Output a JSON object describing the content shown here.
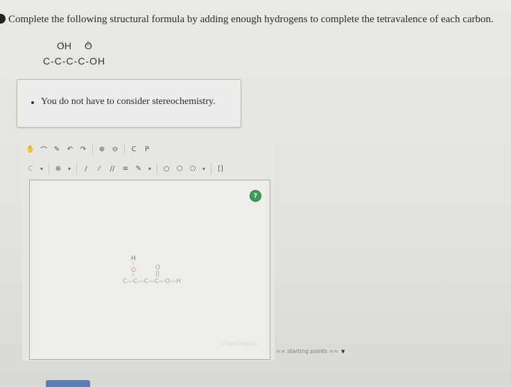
{
  "question": {
    "text": "Complete the following structural formula by adding enough hydrogens to complete the tetravalence of each carbon."
  },
  "formula": {
    "top_left": "OH",
    "top_right": "O",
    "chain": "C-C-C-C-OH"
  },
  "info": {
    "bullet": "You do not have to consider stereochemistry."
  },
  "toolbar": {
    "row1": [
      {
        "name": "hand-icon",
        "glyph": "✋"
      },
      {
        "name": "lasso-icon",
        "glyph": "⌒"
      },
      {
        "name": "eraser-icon",
        "glyph": "✎"
      },
      {
        "name": "undo-icon",
        "glyph": "↶"
      },
      {
        "name": "redo-icon",
        "glyph": "↷"
      },
      {
        "name": "zoom-in-icon",
        "glyph": "⊕"
      },
      {
        "name": "zoom-out-icon",
        "glyph": "⊖"
      },
      {
        "name": "clean-2d-icon",
        "glyph": "C"
      },
      {
        "name": "periodic-table-icon",
        "glyph": "P"
      }
    ],
    "row2": [
      {
        "name": "carbon-atom-icon",
        "glyph": "C"
      },
      {
        "name": "dropdown-icon",
        "glyph": "▾"
      },
      {
        "name": "charge-plus-icon",
        "glyph": "⊕"
      },
      {
        "name": "dropdown-icon",
        "glyph": "▾"
      },
      {
        "name": "single-bond-icon",
        "glyph": "/"
      },
      {
        "name": "wedge-bond-icon",
        "glyph": "⁄"
      },
      {
        "name": "double-bond-icon",
        "glyph": "//"
      },
      {
        "name": "triple-bond-icon",
        "glyph": "≡"
      },
      {
        "name": "chain-tool-icon",
        "glyph": "✎"
      },
      {
        "name": "dropdown-icon",
        "glyph": "▾"
      },
      {
        "name": "cyclopentane-icon",
        "glyph": "○"
      },
      {
        "name": "benzene-icon",
        "glyph": "⬡"
      },
      {
        "name": "cyclohexane-icon",
        "glyph": "⬠"
      },
      {
        "name": "dropdown-icon",
        "glyph": "▾"
      },
      {
        "name": "bracket-icon",
        "glyph": "[]"
      }
    ]
  },
  "help_glyph": "?",
  "molecule": {
    "h_top": "H",
    "o_left": "O",
    "o_right": "O",
    "double_bond": "||",
    "chain": "C—C—C—C—O—H"
  },
  "watermark": "ChemDoodle",
  "starting_points": {
    "label": "== starting points ==",
    "arrow": "▼"
  }
}
